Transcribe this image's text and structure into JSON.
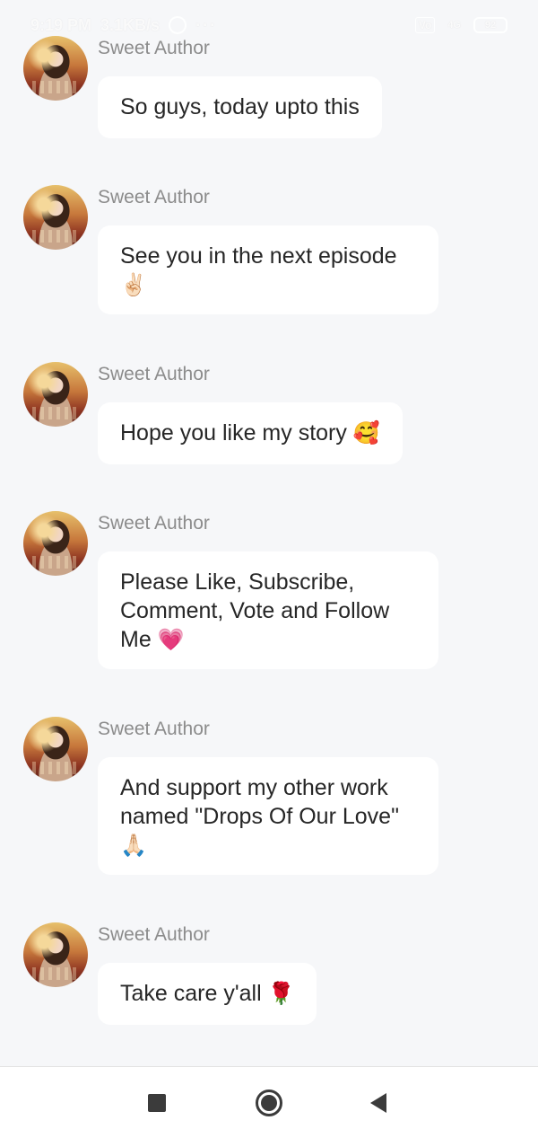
{
  "status_bar": {
    "time": "9:19 PM",
    "speed": "3.1KB/s",
    "more": "···",
    "volte": "Vo",
    "signal": "4G",
    "battery": "92"
  },
  "messages": [
    {
      "author": "Sweet Author",
      "lines": [
        "So guys, today upto this"
      ],
      "emoji": ""
    },
    {
      "author": "Sweet Author",
      "lines": [
        "See you in the next episode"
      ],
      "emoji": "✌🏻"
    },
    {
      "author": "Sweet Author",
      "lines": [
        "Hope you like my story"
      ],
      "emoji": "🥰"
    },
    {
      "author": "Sweet Author",
      "lines": [
        "Please Like, Subscribe,",
        "Comment, Vote and Follow",
        "Me"
      ],
      "emoji": "💗"
    },
    {
      "author": "Sweet Author",
      "lines": [
        "And support my other work",
        "named \"Drops Of Our Love\""
      ],
      "emoji": "🙏🏻"
    },
    {
      "author": "Sweet Author",
      "lines": [
        "Take care y'all"
      ],
      "emoji": "🌹"
    }
  ],
  "nav": {
    "recents_icon": "square-icon",
    "home_icon": "circle-home-icon",
    "back_icon": "triangle-back-icon"
  },
  "colors": {
    "background": "#f6f7f9",
    "bubble": "#ffffff",
    "author_text": "#8c8c8c",
    "message_text": "#262626"
  }
}
